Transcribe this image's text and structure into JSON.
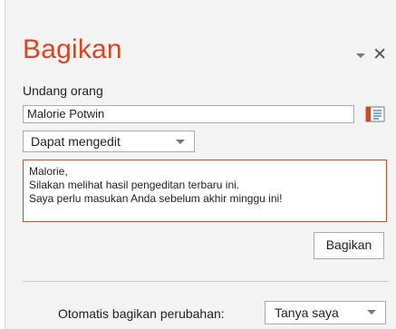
{
  "pane": {
    "title": "Bagikan",
    "dropdown_icon": "chevron-down-icon",
    "close_label": "✕"
  },
  "invite": {
    "label": "Undang orang",
    "name_value": "Malorie Potwin",
    "address_book_icon": "address-book-icon"
  },
  "permission": {
    "selected": "Dapat mengedit"
  },
  "message": {
    "lines": [
      "Malorie,",
      "Silakan melihat hasil pengeditan terbaru ini.",
      "Saya perlu masukan Anda sebelum akhir minggu ini!"
    ]
  },
  "share_button": {
    "label": "Bagikan"
  },
  "auto_share": {
    "label": "Otomatis bagikan perubahan:",
    "selected": "Tanya saya"
  },
  "colors": {
    "accent": "#d24726",
    "background": "#f3f3f3"
  }
}
